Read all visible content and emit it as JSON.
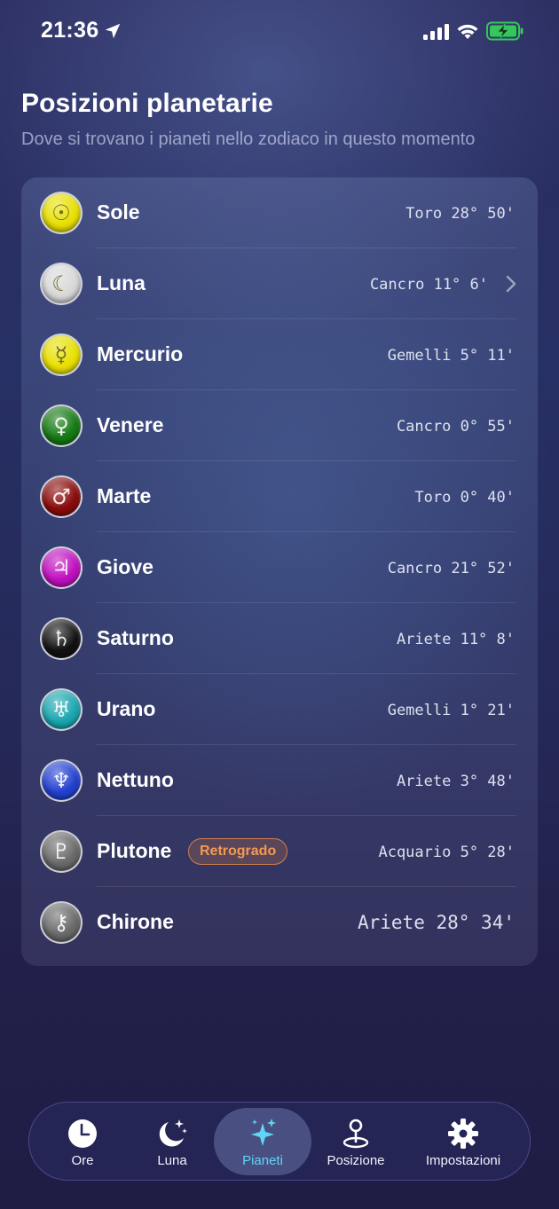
{
  "status_bar": {
    "time": "21:36",
    "icons": [
      "location-arrow-icon",
      "cellular-signal-icon",
      "wifi-icon",
      "battery-charging-icon"
    ],
    "battery_color": "#34c759"
  },
  "header": {
    "title": "Posizioni planetarie",
    "subtitle": "Dove si trovano i pianeti nello zodiaco in questo momento"
  },
  "planets": [
    {
      "name": "Sole",
      "position": "Toro 28° 50'",
      "icon": "sun-icon",
      "glyph": "☉",
      "color": "#e8e000"
    },
    {
      "name": "Luna",
      "position": "Cancro 11° 6'",
      "icon": "moon-icon",
      "glyph": "☾",
      "color": "#d8d8d8",
      "chevron": true
    },
    {
      "name": "Mercurio",
      "position": "Gemelli 5° 11'",
      "icon": "mercury-icon",
      "glyph": "☿",
      "color": "#e8e000"
    },
    {
      "name": "Venere",
      "position": "Cancro 0° 55'",
      "icon": "venus-icon",
      "glyph": "♀",
      "color": "#157a14"
    },
    {
      "name": "Marte",
      "position": "Toro 0° 40'",
      "icon": "mars-icon",
      "glyph": "♂",
      "color": "#8a0c0c"
    },
    {
      "name": "Giove",
      "position": "Cancro 21° 52'",
      "icon": "jupiter-icon",
      "glyph": "♃",
      "color": "#c010c0"
    },
    {
      "name": "Saturno",
      "position": "Ariete 11° 8'",
      "icon": "saturn-icon",
      "glyph": "♄",
      "color": "#111111"
    },
    {
      "name": "Urano",
      "position": "Gemelli 1° 21'",
      "icon": "uranus-icon",
      "glyph": "♅",
      "color": "#1aa6b0"
    },
    {
      "name": "Nettuno",
      "position": "Ariete 3° 48'",
      "icon": "neptune-icon",
      "glyph": "♆",
      "color": "#2240d0"
    },
    {
      "name": "Plutone",
      "position": "Acquario 5° 28'",
      "icon": "pluto-icon",
      "glyph": "♇",
      "color": "#6a6a6a",
      "badge": "Retrogrado"
    },
    {
      "name": "Chirone",
      "position": "Ariete 28° 34'",
      "icon": "chiron-icon",
      "glyph": "⚷",
      "color": "#6a6a6a",
      "big": true
    }
  ],
  "retrograde_color": "#f29a52",
  "tab_bar": {
    "active_color": "#5fd6f5",
    "tabs": [
      {
        "label": "Ore",
        "icon": "clock-icon"
      },
      {
        "label": "Luna",
        "icon": "moon-stars-icon"
      },
      {
        "label": "Pianeti",
        "icon": "sparkles-icon",
        "active": true
      },
      {
        "label": "Posizione",
        "icon": "location-pin-icon"
      },
      {
        "label": "Impostazioni",
        "icon": "gear-icon"
      }
    ]
  }
}
